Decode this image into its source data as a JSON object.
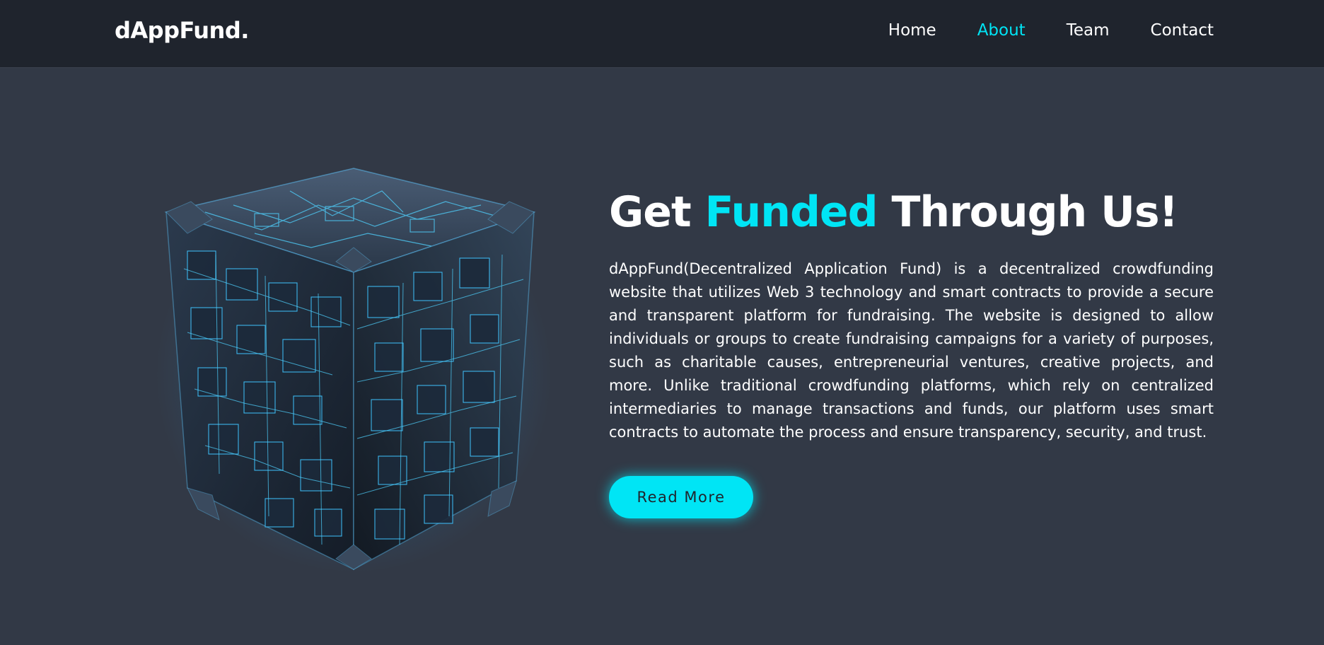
{
  "header": {
    "logo": "dAppFund.",
    "nav": [
      {
        "label": "Home",
        "active": false
      },
      {
        "label": "About",
        "active": true
      },
      {
        "label": "Team",
        "active": false
      },
      {
        "label": "Contact",
        "active": false
      }
    ]
  },
  "about": {
    "image_icon": "blockchain-cube-illustration",
    "headline": {
      "part1": "Get",
      "accent": "Funded",
      "part2": "Through Us!"
    },
    "body": "dAppFund(Decentralized Application Fund) is a decentralized crowdfunding website that utilizes Web 3 technology and smart contracts to provide a secure and transparent platform for fundraising. The website is designed to allow individuals or groups to create fundraising campaigns for a variety of purposes, such as charitable causes, entrepreneurial ventures, creative projects, and more. Unlike traditional crowdfunding platforms, which rely on centralized intermediaries to manage transactions and funds, our platform uses smart contracts to automate the process and ensure transparency, security, and trust.",
    "button_label": "Read More"
  },
  "colors": {
    "accent": "#00e5f5",
    "header_bg": "#1f242d",
    "page_bg": "#323946"
  }
}
